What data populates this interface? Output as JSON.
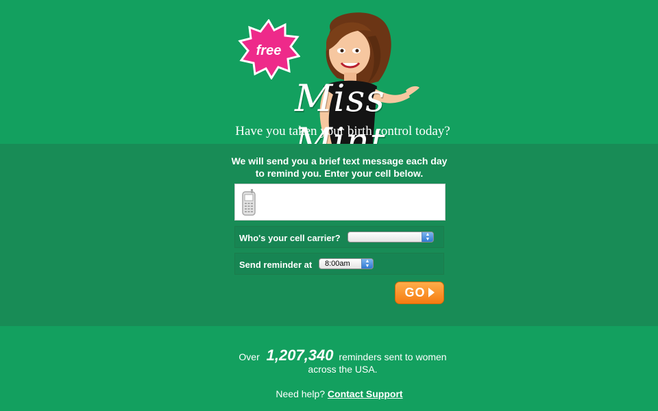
{
  "header": {
    "badge": "free",
    "logo": "Miss Mint",
    "tagline": "Have you taken your birth control today?"
  },
  "form": {
    "intro": "We will send you a brief text message each day to remind you. Enter your cell below.",
    "phone_icon": "cellphone-icon",
    "phone_value": "",
    "carrier_label": "Who's your cell carrier?",
    "carrier_value": "",
    "time_label": "Send reminder at",
    "time_value": "8:00am",
    "go_label": "GO"
  },
  "stats": {
    "prefix": "Over",
    "count": "1,207,340",
    "suffix": "reminders sent to women",
    "line2": "across the USA."
  },
  "help": {
    "text": "Need help?",
    "link": "Contact Support"
  },
  "colors": {
    "background": "#13a05f",
    "band": "#188c56",
    "badge": "#ee2a8a",
    "go_button": "#f7891a"
  }
}
